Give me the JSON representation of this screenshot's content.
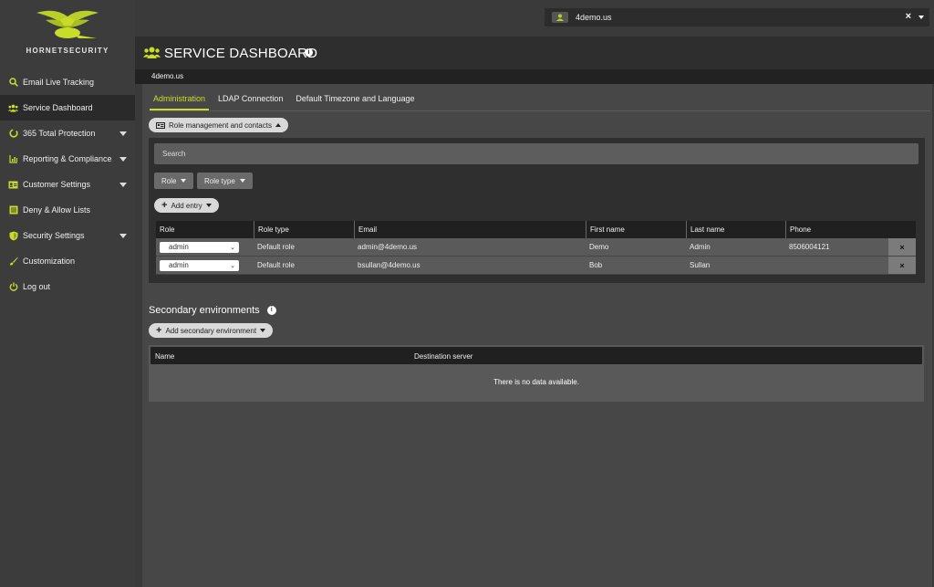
{
  "brand": {
    "name": "HORNETSECURITY",
    "accent": "#c8dd2a"
  },
  "sidebar": {
    "items": [
      {
        "label": "Email Live Tracking",
        "icon": "search-icon",
        "caret": false,
        "active": false
      },
      {
        "label": "Service Dashboard",
        "icon": "users-icon",
        "caret": false,
        "active": true
      },
      {
        "label": "365 Total Protection",
        "icon": "ring-icon",
        "caret": true,
        "active": false
      },
      {
        "label": "Reporting & Compliance",
        "icon": "chart-icon",
        "caret": true,
        "active": false
      },
      {
        "label": "Customer Settings",
        "icon": "id-card-icon",
        "caret": true,
        "active": false
      },
      {
        "label": "Deny & Allow Lists",
        "icon": "list-icon",
        "caret": false,
        "active": false
      },
      {
        "label": "Security Settings",
        "icon": "shield-icon",
        "caret": true,
        "active": false
      },
      {
        "label": "Customization",
        "icon": "brush-icon",
        "caret": false,
        "active": false
      },
      {
        "label": "Log out",
        "icon": "power-icon",
        "caret": false,
        "active": false
      }
    ]
  },
  "domain_selector": {
    "value": "4demo.us",
    "clear": "×"
  },
  "header": {
    "title": "SERVICE DASHBOARD",
    "info": "i",
    "domain": "4demo.us"
  },
  "tabs": [
    "Administration",
    "LDAP Connection",
    "Default Timezone and Language"
  ],
  "role_management": {
    "toggle_label": "Role management and contacts",
    "search_placeholder": "Search",
    "filter_role": "Role",
    "filter_role_type": "Role type",
    "add_entry": "Add entry",
    "columns": [
      "Role",
      "Role type",
      "Email",
      "First name",
      "Last name",
      "Phone"
    ],
    "rows": [
      {
        "role": "admin",
        "role_type": "Default role",
        "email": "admin@4demo.us",
        "first": "Demo",
        "last": "Admin",
        "phone": "8506004121",
        "delete": "×"
      },
      {
        "role": "admin",
        "role_type": "Default role",
        "email": "bsullan@4demo.us",
        "first": "Bob",
        "last": "Sullan",
        "phone": "",
        "delete": "×"
      }
    ]
  },
  "secondary": {
    "title": "Secondary environments",
    "info": "i",
    "add_label": "Add secondary environment",
    "columns": [
      "Name",
      "Destination server"
    ],
    "empty": "There is no data available."
  }
}
